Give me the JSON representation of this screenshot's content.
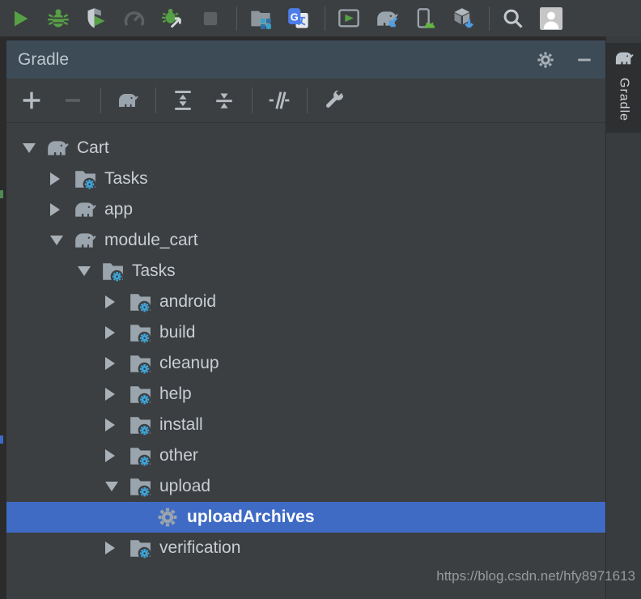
{
  "top_toolbar": {
    "items": [
      {
        "name": "run"
      },
      {
        "name": "debug"
      },
      {
        "name": "run-with-coverage"
      },
      {
        "name": "profiler",
        "disabled": true
      },
      {
        "name": "attach-debugger"
      },
      {
        "name": "stop",
        "disabled": true
      },
      {
        "sep": true
      },
      {
        "name": "capture-layout"
      },
      {
        "name": "translate"
      },
      {
        "sep": true
      },
      {
        "name": "run-terminal"
      },
      {
        "name": "gradle-sync"
      },
      {
        "name": "avd-manager"
      },
      {
        "name": "sdk-manager"
      },
      {
        "sep": true
      },
      {
        "name": "search-everywhere"
      },
      {
        "name": "avatar"
      }
    ]
  },
  "panel": {
    "title": "Gradle",
    "header_icons": [
      {
        "name": "settings-gear"
      },
      {
        "name": "minimize"
      }
    ],
    "toolbar": {
      "items": [
        {
          "name": "add"
        },
        {
          "name": "remove",
          "disabled": true
        },
        {
          "sep": true
        },
        {
          "name": "gradle-refresh"
        },
        {
          "sep": true
        },
        {
          "name": "expand-all"
        },
        {
          "name": "collapse-all"
        },
        {
          "sep": true
        },
        {
          "name": "toggle-offline"
        },
        {
          "sep": true
        },
        {
          "name": "gradle-settings-wrench"
        }
      ]
    },
    "tree": {
      "items": [
        {
          "label": "Cart",
          "level": 0,
          "state": "expanded",
          "icon": "elephant",
          "selected": false
        },
        {
          "label": "Tasks",
          "level": 1,
          "state": "collapsed",
          "icon": "folder-gear",
          "selected": false
        },
        {
          "label": "app",
          "level": 1,
          "state": "collapsed",
          "icon": "elephant",
          "selected": false
        },
        {
          "label": "module_cart",
          "level": 1,
          "state": "expanded",
          "icon": "elephant",
          "selected": false
        },
        {
          "label": "Tasks",
          "level": 2,
          "state": "expanded",
          "icon": "folder-gear",
          "selected": false
        },
        {
          "label": "android",
          "level": 3,
          "state": "collapsed",
          "icon": "folder-gear",
          "selected": false
        },
        {
          "label": "build",
          "level": 3,
          "state": "collapsed",
          "icon": "folder-gear",
          "selected": false
        },
        {
          "label": "cleanup",
          "level": 3,
          "state": "collapsed",
          "icon": "folder-gear",
          "selected": false
        },
        {
          "label": "help",
          "level": 3,
          "state": "collapsed",
          "icon": "folder-gear",
          "selected": false
        },
        {
          "label": "install",
          "level": 3,
          "state": "collapsed",
          "icon": "folder-gear",
          "selected": false
        },
        {
          "label": "other",
          "level": 3,
          "state": "collapsed",
          "icon": "folder-gear",
          "selected": false
        },
        {
          "label": "upload",
          "level": 3,
          "state": "expanded",
          "icon": "folder-gear",
          "selected": false
        },
        {
          "label": "uploadArchives",
          "level": 4,
          "state": "leaf",
          "icon": "gear",
          "selected": true
        },
        {
          "label": "verification",
          "level": 3,
          "state": "collapsed",
          "icon": "folder-gear",
          "selected": false
        }
      ]
    }
  },
  "right_tab": {
    "label": "Gradle",
    "icon": "gradle-elephant"
  },
  "watermark": "https://blog.csdn.net/hfy8971613",
  "colors": {
    "selection_blue": "#3f6bc4",
    "gear_blue": "#3fa7dc",
    "run_green": "#56a045",
    "header_slate": "#3d4b57",
    "panel_bg": "#3c3f41"
  }
}
